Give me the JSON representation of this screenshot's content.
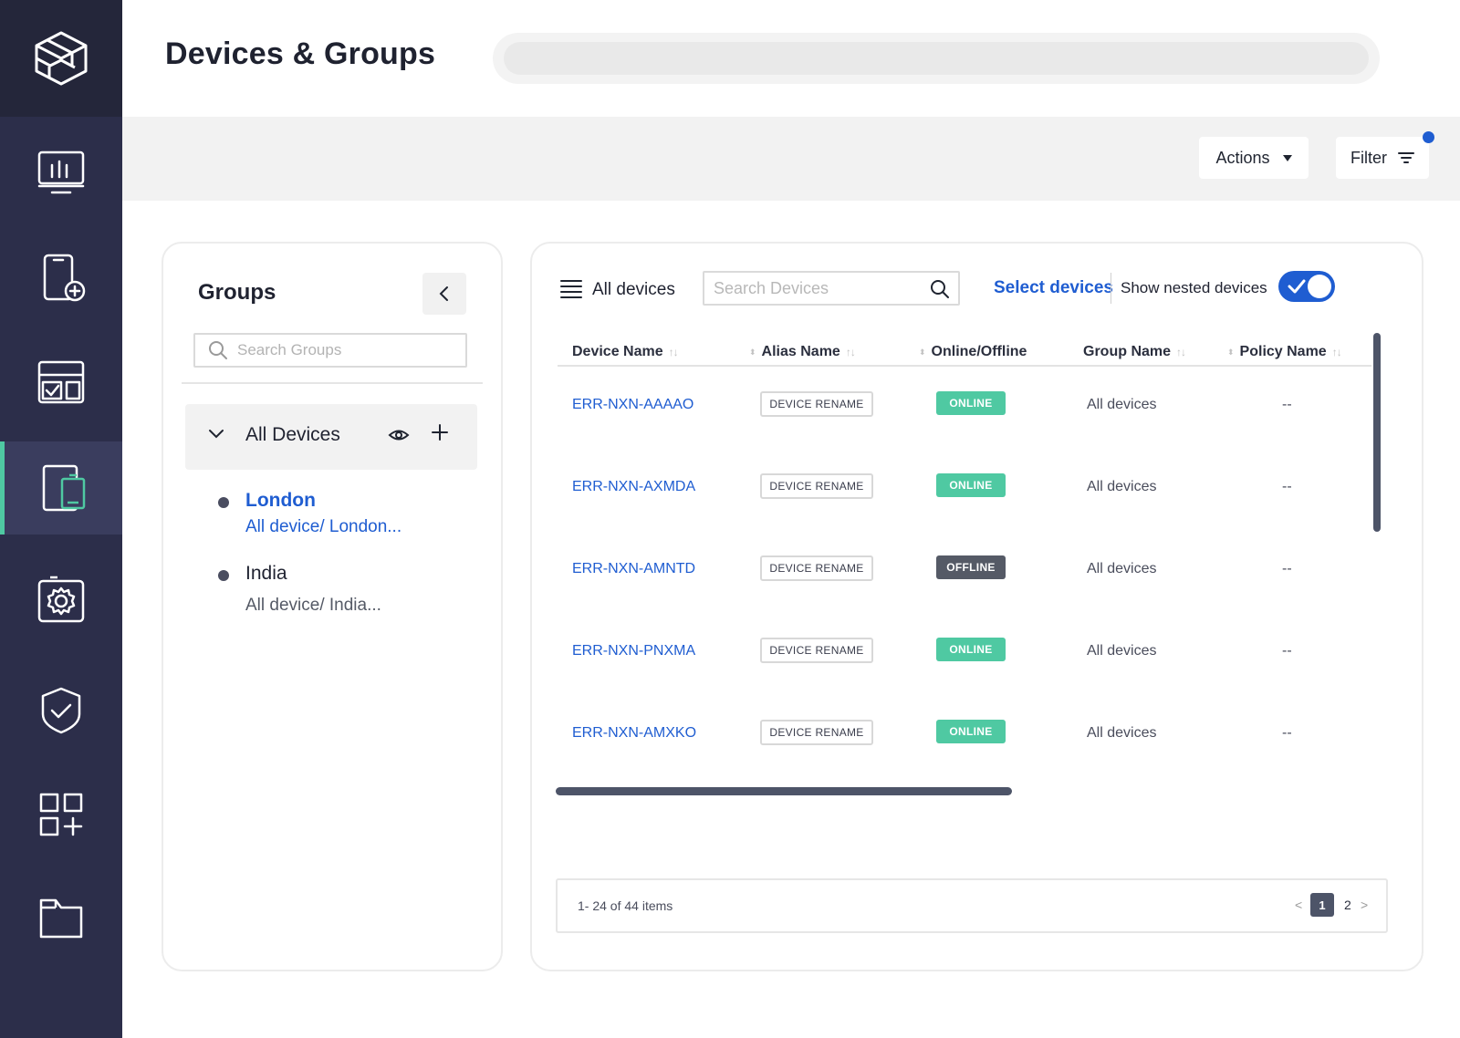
{
  "header": {
    "title": "Devices & Groups"
  },
  "toolbar": {
    "actions_label": "Actions",
    "filter_label": "Filter"
  },
  "sidebar": {
    "items": [
      {
        "icon": "dashboard-monitor-icon"
      },
      {
        "icon": "add-device-icon"
      },
      {
        "icon": "layout-tasks-icon"
      },
      {
        "icon": "devices-icon",
        "active": true
      },
      {
        "icon": "settings-gear-icon"
      },
      {
        "icon": "shield-check-icon"
      },
      {
        "icon": "apps-add-icon"
      },
      {
        "icon": "folder-icon"
      }
    ]
  },
  "groups": {
    "title": "Groups",
    "search_placeholder": "Search Groups",
    "root_label": "All Devices",
    "items": [
      {
        "name": "London",
        "path": "All device/ London...",
        "selected": true
      },
      {
        "name": "India",
        "path": "All device/ India...",
        "selected": false
      }
    ]
  },
  "devices": {
    "view_label": "All devices",
    "search_placeholder": "Search Devices",
    "select_devices_label": "Select devices",
    "show_nested_label": "Show nested devices",
    "show_nested_enabled": true,
    "columns": [
      "Device Name",
      "Alias Name",
      "Online/Offline",
      "Group Name",
      "Policy Name"
    ],
    "rows": [
      {
        "device": "ERR-NXN-AAAAO",
        "alias": "DEVICE RENAME",
        "status": "ONLINE",
        "group": "All devices",
        "policy": "--"
      },
      {
        "device": "ERR-NXN-AXMDA",
        "alias": "DEVICE RENAME",
        "status": "ONLINE",
        "group": "All devices",
        "policy": "--"
      },
      {
        "device": "ERR-NXN-AMNTD",
        "alias": "DEVICE RENAME",
        "status": "OFFLINE",
        "group": "All devices",
        "policy": "--"
      },
      {
        "device": "ERR-NXN-PNXMA",
        "alias": "DEVICE RENAME",
        "status": "ONLINE",
        "group": "All devices",
        "policy": "--"
      },
      {
        "device": "ERR-NXN-AMXKO",
        "alias": "DEVICE RENAME",
        "status": "ONLINE",
        "group": "All devices",
        "policy": "--"
      }
    ],
    "pagination": {
      "summary": "1- 24 of 44 items",
      "prev": "<",
      "current_page": "1",
      "next_page": "2",
      "next": ">"
    }
  },
  "colors": {
    "sidebar_bg": "#2c2e4a",
    "accent_blue": "#1f5dd1",
    "online_green": "#4fc9a2",
    "offline_gray": "#555a66",
    "active_indicator": "#4fc9a2"
  }
}
